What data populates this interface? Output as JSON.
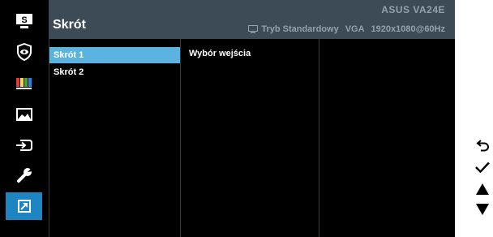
{
  "header": {
    "title": "Skrót",
    "brand": "ASUS  VA24E",
    "mode": "Tryb Standardowy",
    "input": "VGA",
    "resolution": "1920x1080@60Hz"
  },
  "menu": {
    "items": [
      {
        "icon": "splendid-icon",
        "label": "S"
      },
      {
        "icon": "eye-care-icon"
      },
      {
        "icon": "color-icon"
      },
      {
        "icon": "image-icon"
      },
      {
        "icon": "input-select-icon"
      },
      {
        "icon": "system-setup-icon"
      },
      {
        "icon": "shortcut-icon",
        "active": true
      }
    ]
  },
  "submenu": {
    "items": [
      "Skrót 1",
      "Skrót 2"
    ],
    "selected": "Skrót 1"
  },
  "options": {
    "value": "Wybór wejścia"
  },
  "nav": {
    "buttons": [
      "back-icon",
      "confirm-icon",
      "up-icon",
      "down-icon"
    ]
  },
  "colors": {
    "accent": "#1e85c3",
    "selected": "#5bb3e1",
    "header": "#3d4b57"
  }
}
